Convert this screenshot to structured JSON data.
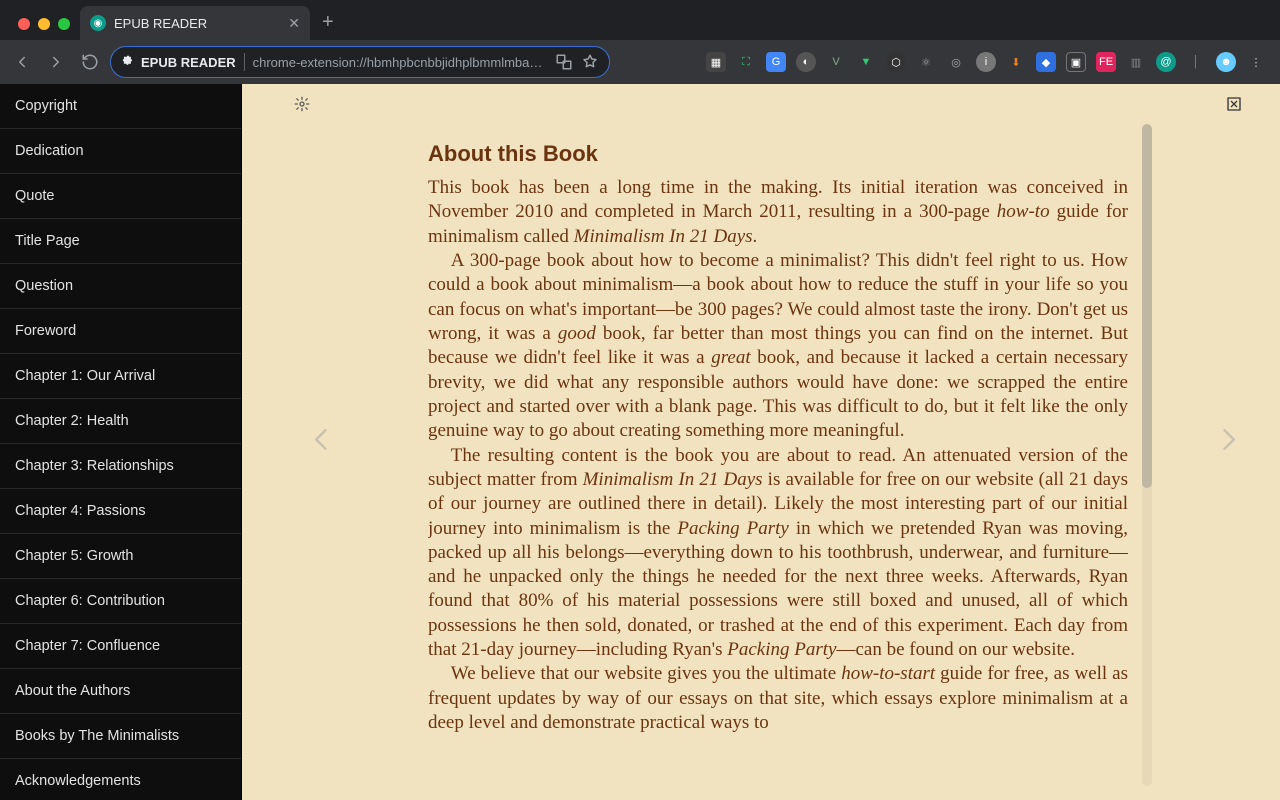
{
  "browser": {
    "tab_title": "EPUB READER",
    "omnibox_label": "EPUB READER",
    "url": "chrome-extension://hbmhpbcnbbjidhplbmmlmbaoh…",
    "extension_icons": [
      "qr",
      "fullscreen",
      "translate",
      "adblock",
      "vue",
      "shield",
      "eslint",
      "react",
      "target",
      "info",
      "download",
      "clip",
      "image",
      "fe",
      "library",
      "at",
      "menu"
    ]
  },
  "toc": [
    "Copyright",
    "Dedication",
    "Quote",
    "Title Page",
    "Question",
    "Foreword",
    "Chapter 1: Our Arrival",
    "Chapter 2: Health",
    "Chapter 3: Relationships",
    "Chapter 4: Passions",
    "Chapter 5: Growth",
    "Chapter 6: Contribution",
    "Chapter 7: Confluence",
    "About the Authors",
    "Books by The Minimalists",
    "Acknowledgements"
  ],
  "content": {
    "heading": "About this Book",
    "p1_a": "This book has been a long time in the making. Its initial iteration was conceived in November 2010 and completed in March 2011, resulting in a 300-page ",
    "p1_em1": "how-to",
    "p1_b": " guide for minimalism called ",
    "p1_em2": "Minimalism In 21 Days",
    "p1_c": ".",
    "p2_a": "A 300-page book about how to become a minimalist? This didn't feel right to us. How could a book about minimalism—a book about how to reduce the stuff in your life so you can focus on what's important—be 300 pages? We could almost taste the irony. Don't get us wrong, it was a ",
    "p2_em1": "good",
    "p2_b": " book, far better than most things you can find on the internet. But because we didn't feel like it was a ",
    "p2_em2": "great",
    "p2_c": " book, and because it lacked a certain necessary brevity, we did what any responsible authors would have done: we scrapped the entire project and started over with a blank page. This was difficult to do, but it felt like the only genuine way to go about creating something more meaningful.",
    "p3_a": "The resulting content is the book you are about to read. An attenuated version of the subject matter from ",
    "p3_em1": "Minimalism In 21 Days",
    "p3_b": " is available for free on our website (all 21 days of our journey are outlined there in detail). Likely the most interesting part of our initial journey into minimalism is the ",
    "p3_em2": "Packing Party",
    "p3_c": " in which we pretended Ryan was moving, packed up all his belongs—everything down to his toothbrush, underwear, and furniture—and he unpacked only the things he needed for the next three weeks. Afterwards, Ryan found that 80% of his material possessions were still boxed and unused, all of which possessions he then sold, donated, or trashed at the end of this experiment. Each day from that 21-day journey—including Ryan's ",
    "p3_em3": "Packing Party",
    "p3_d": "—can be found on our website.",
    "p4_a": "We believe that our website gives you the ultimate ",
    "p4_em1": "how-to-start",
    "p4_b": " guide for free, as well as frequent updates by way of our essays on that site, which essays explore minimalism at a deep level and demonstrate practical ways to"
  },
  "colors": {
    "reader_bg": "#f1e2c0",
    "text": "#6b3410"
  }
}
